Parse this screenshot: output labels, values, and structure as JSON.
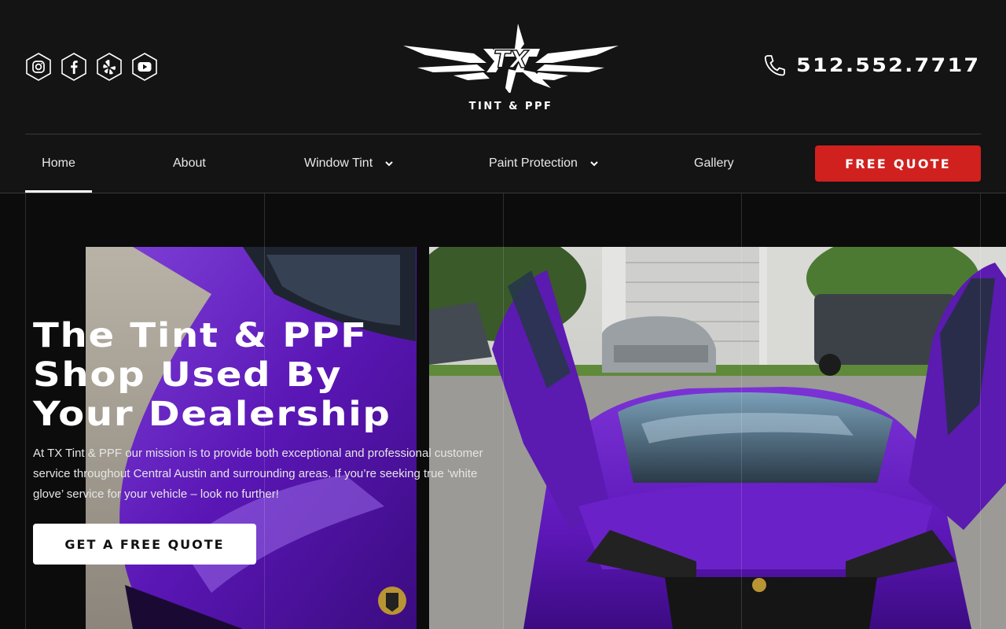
{
  "header": {
    "socials": [
      {
        "icon": "instagram-icon"
      },
      {
        "icon": "facebook-icon"
      },
      {
        "icon": "yelp-icon"
      },
      {
        "icon": "youtube-icon"
      }
    ],
    "logo": {
      "mark": "TX",
      "subtitle": "TINT & PPF"
    },
    "phone": {
      "number": "512.552.7717",
      "icon": "phone-icon"
    }
  },
  "nav": {
    "items": [
      {
        "label": "Home",
        "active": true
      },
      {
        "label": "About"
      },
      {
        "label": "Window Tint",
        "dropdown": true
      },
      {
        "label": "Paint Protection",
        "dropdown": true
      },
      {
        "label": "Gallery"
      }
    ],
    "cta_label": "FREE QUOTE"
  },
  "hero": {
    "title_lines": [
      "The Tint & PPF",
      "Shop Used By",
      "Your Dealership"
    ],
    "text": "At TX Tint & PPF our mission is to provide both exceptional and professional customer service throughout Central Austin and surrounding areas. If you’re seeking true ‘white glove’ service for your vehicle – look no further!",
    "cta_label": "GET A FREE QUOTE"
  },
  "colors": {
    "background": "#121212",
    "accent_red": "#d0211f",
    "car_purple": "#6a1fc4"
  }
}
